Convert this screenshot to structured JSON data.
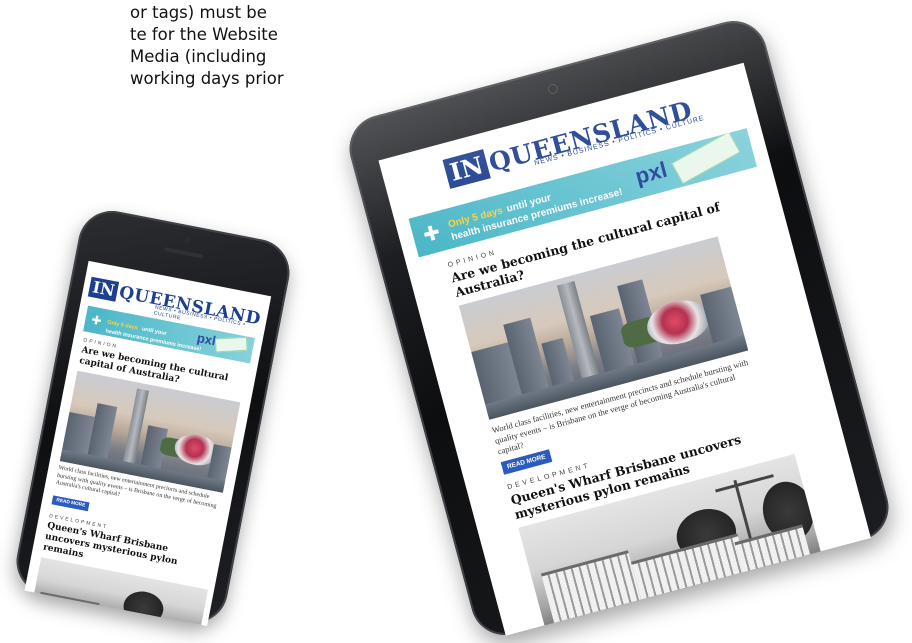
{
  "intro": {
    "lines": [
      "or tags) must be",
      "te for the Website",
      "Media (including",
      " working days prior"
    ]
  },
  "masthead": {
    "logo_in": "IN",
    "logo_name": "QUEENSLAND",
    "tagline": "NEWS • BUSINESS • POLITICS • CULTURE"
  },
  "banner": {
    "highlight": "Only 5 days",
    "text_rest": "until your",
    "text_line2": "health insurance premiums increase!",
    "brand_mark": "pxl"
  },
  "articles": [
    {
      "section": "OPINION",
      "headline": "Are we becoming the cultural capital of Australia?",
      "excerpt": "World class facilities, new entertainment precincts and schedule bursting with quality events – is Brisbane on the verge of becoming Australia's cultural capital?",
      "button": "READ MORE"
    },
    {
      "section": "DEVELOPMENT",
      "headline": "Queen's Wharf Brisbane uncovers mysterious pylon remains"
    }
  ],
  "colors": {
    "brand_blue": "#1d3f8f",
    "banner_teal": "#4bb7c7",
    "banner_yellow": "#f6d44a",
    "button_blue": "#2a5bbf",
    "device_black": "#111214"
  }
}
